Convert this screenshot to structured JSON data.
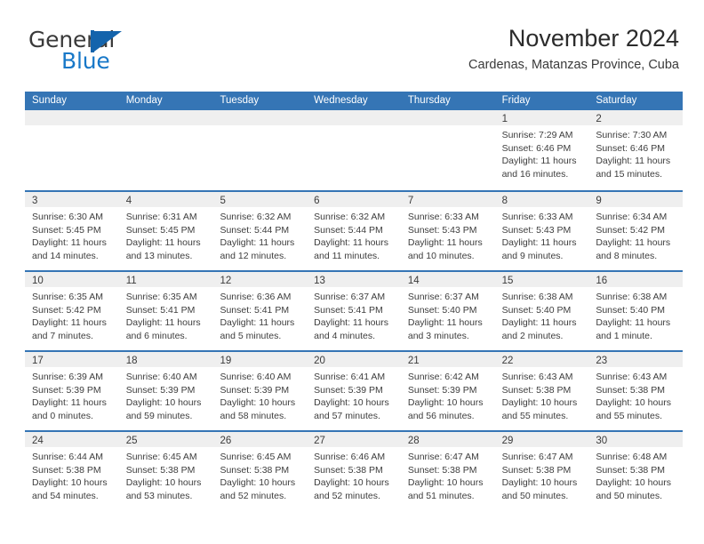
{
  "brand": {
    "name_top": "General",
    "name_bottom": "Blue",
    "flag_icon": "flag-triangle-icon",
    "color_blue": "#1878c8",
    "color_flag": "#1464ac",
    "color_text": "#3a3a3a"
  },
  "header": {
    "month_title": "November 2024",
    "location": "Cardenas, Matanzas Province, Cuba"
  },
  "theme": {
    "header_blue": "#3575b5",
    "band_gray": "#efefef",
    "text": "#3d3d3d"
  },
  "weekdays": [
    "Sunday",
    "Monday",
    "Tuesday",
    "Wednesday",
    "Thursday",
    "Friday",
    "Saturday"
  ],
  "weeks": [
    [
      {
        "day": "",
        "empty": true
      },
      {
        "day": "",
        "empty": true
      },
      {
        "day": "",
        "empty": true
      },
      {
        "day": "",
        "empty": true
      },
      {
        "day": "",
        "empty": true
      },
      {
        "day": "1",
        "sunrise": "Sunrise: 7:29 AM",
        "sunset": "Sunset: 6:46 PM",
        "daylight1": "Daylight: 11 hours",
        "daylight2": "and 16 minutes."
      },
      {
        "day": "2",
        "sunrise": "Sunrise: 7:30 AM",
        "sunset": "Sunset: 6:46 PM",
        "daylight1": "Daylight: 11 hours",
        "daylight2": "and 15 minutes."
      }
    ],
    [
      {
        "day": "3",
        "sunrise": "Sunrise: 6:30 AM",
        "sunset": "Sunset: 5:45 PM",
        "daylight1": "Daylight: 11 hours",
        "daylight2": "and 14 minutes."
      },
      {
        "day": "4",
        "sunrise": "Sunrise: 6:31 AM",
        "sunset": "Sunset: 5:45 PM",
        "daylight1": "Daylight: 11 hours",
        "daylight2": "and 13 minutes."
      },
      {
        "day": "5",
        "sunrise": "Sunrise: 6:32 AM",
        "sunset": "Sunset: 5:44 PM",
        "daylight1": "Daylight: 11 hours",
        "daylight2": "and 12 minutes."
      },
      {
        "day": "6",
        "sunrise": "Sunrise: 6:32 AM",
        "sunset": "Sunset: 5:44 PM",
        "daylight1": "Daylight: 11 hours",
        "daylight2": "and 11 minutes."
      },
      {
        "day": "7",
        "sunrise": "Sunrise: 6:33 AM",
        "sunset": "Sunset: 5:43 PM",
        "daylight1": "Daylight: 11 hours",
        "daylight2": "and 10 minutes."
      },
      {
        "day": "8",
        "sunrise": "Sunrise: 6:33 AM",
        "sunset": "Sunset: 5:43 PM",
        "daylight1": "Daylight: 11 hours",
        "daylight2": "and 9 minutes."
      },
      {
        "day": "9",
        "sunrise": "Sunrise: 6:34 AM",
        "sunset": "Sunset: 5:42 PM",
        "daylight1": "Daylight: 11 hours",
        "daylight2": "and 8 minutes."
      }
    ],
    [
      {
        "day": "10",
        "sunrise": "Sunrise: 6:35 AM",
        "sunset": "Sunset: 5:42 PM",
        "daylight1": "Daylight: 11 hours",
        "daylight2": "and 7 minutes."
      },
      {
        "day": "11",
        "sunrise": "Sunrise: 6:35 AM",
        "sunset": "Sunset: 5:41 PM",
        "daylight1": "Daylight: 11 hours",
        "daylight2": "and 6 minutes."
      },
      {
        "day": "12",
        "sunrise": "Sunrise: 6:36 AM",
        "sunset": "Sunset: 5:41 PM",
        "daylight1": "Daylight: 11 hours",
        "daylight2": "and 5 minutes."
      },
      {
        "day": "13",
        "sunrise": "Sunrise: 6:37 AM",
        "sunset": "Sunset: 5:41 PM",
        "daylight1": "Daylight: 11 hours",
        "daylight2": "and 4 minutes."
      },
      {
        "day": "14",
        "sunrise": "Sunrise: 6:37 AM",
        "sunset": "Sunset: 5:40 PM",
        "daylight1": "Daylight: 11 hours",
        "daylight2": "and 3 minutes."
      },
      {
        "day": "15",
        "sunrise": "Sunrise: 6:38 AM",
        "sunset": "Sunset: 5:40 PM",
        "daylight1": "Daylight: 11 hours",
        "daylight2": "and 2 minutes."
      },
      {
        "day": "16",
        "sunrise": "Sunrise: 6:38 AM",
        "sunset": "Sunset: 5:40 PM",
        "daylight1": "Daylight: 11 hours",
        "daylight2": "and 1 minute."
      }
    ],
    [
      {
        "day": "17",
        "sunrise": "Sunrise: 6:39 AM",
        "sunset": "Sunset: 5:39 PM",
        "daylight1": "Daylight: 11 hours",
        "daylight2": "and 0 minutes."
      },
      {
        "day": "18",
        "sunrise": "Sunrise: 6:40 AM",
        "sunset": "Sunset: 5:39 PM",
        "daylight1": "Daylight: 10 hours",
        "daylight2": "and 59 minutes."
      },
      {
        "day": "19",
        "sunrise": "Sunrise: 6:40 AM",
        "sunset": "Sunset: 5:39 PM",
        "daylight1": "Daylight: 10 hours",
        "daylight2": "and 58 minutes."
      },
      {
        "day": "20",
        "sunrise": "Sunrise: 6:41 AM",
        "sunset": "Sunset: 5:39 PM",
        "daylight1": "Daylight: 10 hours",
        "daylight2": "and 57 minutes."
      },
      {
        "day": "21",
        "sunrise": "Sunrise: 6:42 AM",
        "sunset": "Sunset: 5:39 PM",
        "daylight1": "Daylight: 10 hours",
        "daylight2": "and 56 minutes."
      },
      {
        "day": "22",
        "sunrise": "Sunrise: 6:43 AM",
        "sunset": "Sunset: 5:38 PM",
        "daylight1": "Daylight: 10 hours",
        "daylight2": "and 55 minutes."
      },
      {
        "day": "23",
        "sunrise": "Sunrise: 6:43 AM",
        "sunset": "Sunset: 5:38 PM",
        "daylight1": "Daylight: 10 hours",
        "daylight2": "and 55 minutes."
      }
    ],
    [
      {
        "day": "24",
        "sunrise": "Sunrise: 6:44 AM",
        "sunset": "Sunset: 5:38 PM",
        "daylight1": "Daylight: 10 hours",
        "daylight2": "and 54 minutes."
      },
      {
        "day": "25",
        "sunrise": "Sunrise: 6:45 AM",
        "sunset": "Sunset: 5:38 PM",
        "daylight1": "Daylight: 10 hours",
        "daylight2": "and 53 minutes."
      },
      {
        "day": "26",
        "sunrise": "Sunrise: 6:45 AM",
        "sunset": "Sunset: 5:38 PM",
        "daylight1": "Daylight: 10 hours",
        "daylight2": "and 52 minutes."
      },
      {
        "day": "27",
        "sunrise": "Sunrise: 6:46 AM",
        "sunset": "Sunset: 5:38 PM",
        "daylight1": "Daylight: 10 hours",
        "daylight2": "and 52 minutes."
      },
      {
        "day": "28",
        "sunrise": "Sunrise: 6:47 AM",
        "sunset": "Sunset: 5:38 PM",
        "daylight1": "Daylight: 10 hours",
        "daylight2": "and 51 minutes."
      },
      {
        "day": "29",
        "sunrise": "Sunrise: 6:47 AM",
        "sunset": "Sunset: 5:38 PM",
        "daylight1": "Daylight: 10 hours",
        "daylight2": "and 50 minutes."
      },
      {
        "day": "30",
        "sunrise": "Sunrise: 6:48 AM",
        "sunset": "Sunset: 5:38 PM",
        "daylight1": "Daylight: 10 hours",
        "daylight2": "and 50 minutes."
      }
    ]
  ]
}
